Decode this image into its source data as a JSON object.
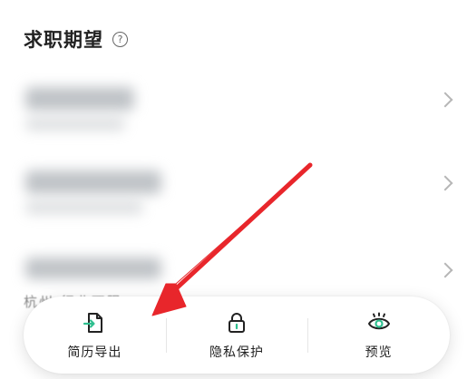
{
  "section": {
    "title": "求职期望",
    "help_icon": "question-circle-icon"
  },
  "rows": [
    {
      "content": "blurred",
      "chevron_icon": "chevron-right-icon"
    },
    {
      "content": "blurred",
      "chevron_icon": "chevron-right-icon"
    },
    {
      "content": "blurred",
      "chevron_icon": "chevron-right-icon"
    }
  ],
  "row_peek_text": "杭州 行业不限",
  "action_bar": {
    "items": [
      {
        "label": "简历导出",
        "icon": "resume-export-icon"
      },
      {
        "label": "隐私保护",
        "icon": "lock-icon"
      },
      {
        "label": "预览",
        "icon": "eye-icon"
      }
    ]
  },
  "annotation": {
    "arrow_color": "#e8262b",
    "points_to": "简历导出"
  },
  "colors": {
    "accent": "#2fbf8f",
    "text": "#222222",
    "chevron": "#b6b6b6"
  }
}
